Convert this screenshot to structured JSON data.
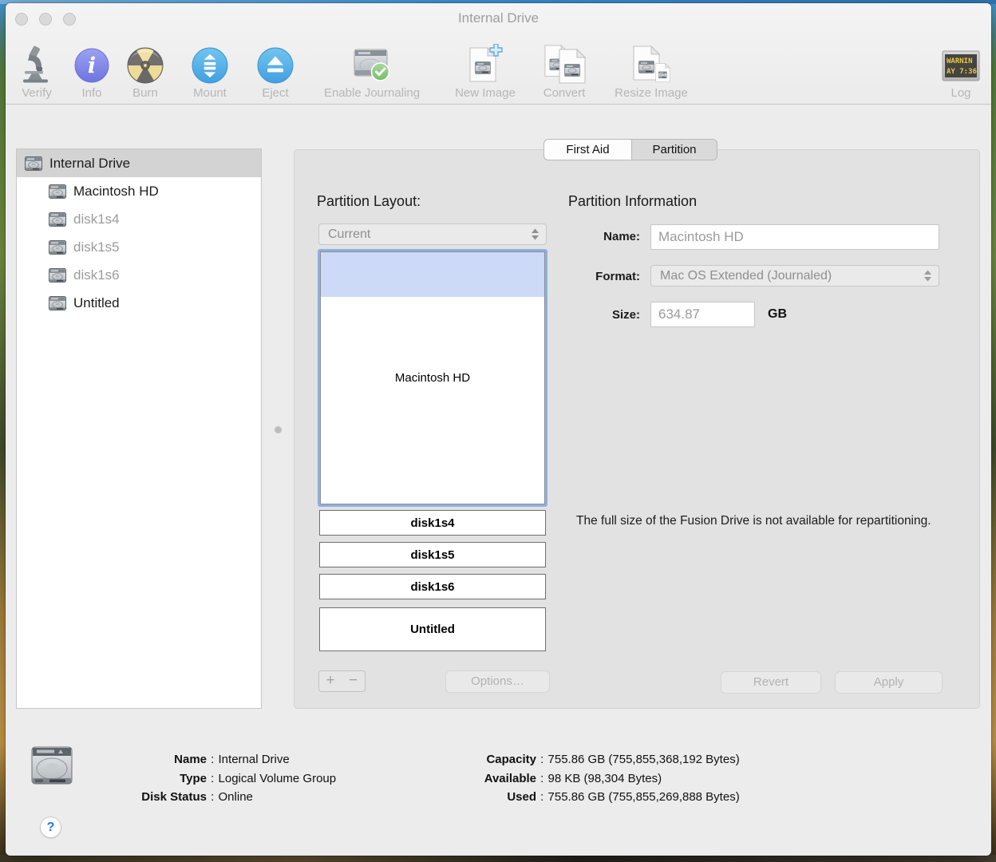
{
  "window": {
    "title": "Internal Drive"
  },
  "toolbar": {
    "items": [
      {
        "label": "Verify"
      },
      {
        "label": "Info"
      },
      {
        "label": "Burn"
      },
      {
        "label": "Mount"
      },
      {
        "label": "Eject"
      },
      {
        "label": "Enable Journaling"
      },
      {
        "label": "New Image"
      },
      {
        "label": "Convert"
      },
      {
        "label": "Resize Image"
      },
      {
        "label": "Log"
      }
    ],
    "log_screen": {
      "line1": "WARNIN",
      "line2": "AY 7:36"
    }
  },
  "sidebar": {
    "items": [
      {
        "label": "Internal Drive"
      },
      {
        "label": "Macintosh HD"
      },
      {
        "label": "disk1s4"
      },
      {
        "label": "disk1s5"
      },
      {
        "label": "disk1s6"
      },
      {
        "label": "Untitled"
      }
    ]
  },
  "tabs": {
    "first_aid": "First Aid",
    "partition": "Partition",
    "selected": "Partition"
  },
  "partition_panel": {
    "layout_label": "Partition Layout:",
    "layout_select": "Current",
    "map": [
      {
        "label": "Macintosh HD"
      },
      {
        "label": "disk1s4"
      },
      {
        "label": "disk1s5"
      },
      {
        "label": "disk1s6"
      },
      {
        "label": "Untitled"
      }
    ],
    "add_button": "+",
    "remove_button": "−",
    "options_button": "Options…",
    "info_title": "Partition Information",
    "name_label": "Name:",
    "name_value": "Macintosh HD",
    "format_label": "Format:",
    "format_value": "Mac OS Extended (Journaled)",
    "size_label": "Size:",
    "size_value": "634.87",
    "size_unit": "GB",
    "note": "The full size of the Fusion Drive is not available for repartitioning.",
    "revert_button": "Revert",
    "apply_button": "Apply"
  },
  "status": {
    "separator": " : ",
    "rows_left": [
      {
        "label": "Name",
        "value": "Internal Drive"
      },
      {
        "label": "Type",
        "value": "Logical Volume Group"
      },
      {
        "label": "Disk Status",
        "value": "Online"
      }
    ],
    "rows_right": [
      {
        "label": "Capacity",
        "value": "755.86 GB (755,855,368,192 Bytes)"
      },
      {
        "label": "Available",
        "value": "98 KB (98,304 Bytes)"
      },
      {
        "label": "Used",
        "value": "755.86 GB (755,855,269,888 Bytes)"
      }
    ]
  },
  "help_button": "?",
  "colors": {
    "selection_blue": "#8cb0e2",
    "used_band_blue": "#ccd9f7",
    "info_purple": "#7d84e6",
    "action_blue": "#58b6ec",
    "burn_yellow": "#f2e0a2",
    "check_green": "#7cc370",
    "log_text_yellow": "#e8c84a"
  }
}
